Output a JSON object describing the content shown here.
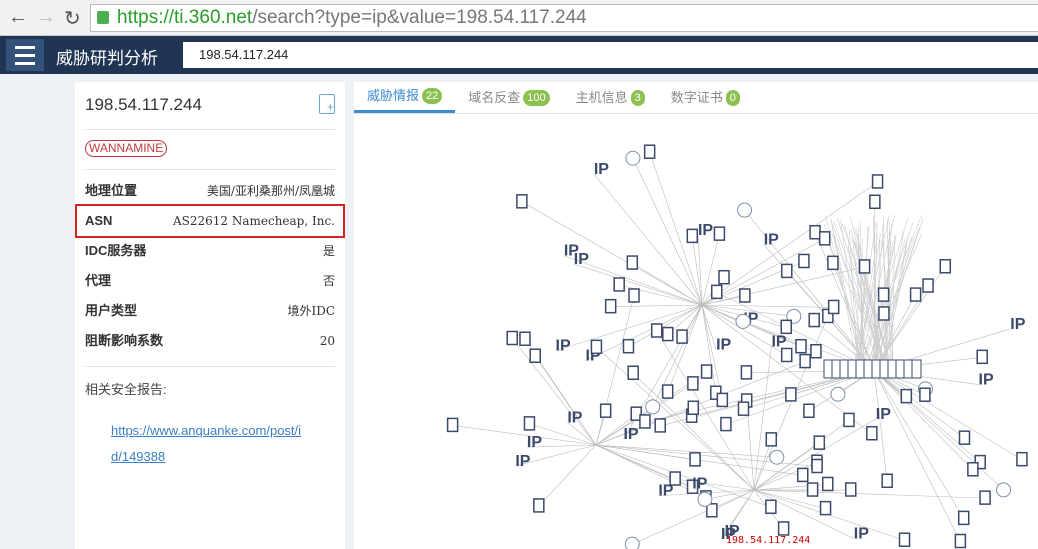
{
  "browser": {
    "url_host": "https://ti.360.net",
    "url_path": "/search?type=ip&value=198.54.117.244"
  },
  "app": {
    "title": "威胁研判分析",
    "search_value": "198.54.117.244"
  },
  "info": {
    "ip": "198.54.117.244",
    "tag": "WANNAMINE",
    "rows": [
      {
        "k": "地理位置",
        "v": "美国/亚利桑那州/凤凰城"
      },
      {
        "k": "ASN",
        "v": "AS22612 Namecheap, Inc."
      },
      {
        "k": "IDC服务器",
        "v": "是"
      },
      {
        "k": "代理",
        "v": "否"
      },
      {
        "k": "用户类型",
        "v": "境外IDC"
      },
      {
        "k": "阻断影响系数",
        "v": "20"
      }
    ],
    "reports_label": "相关安全报告:",
    "report_link": "https://www.anquanke.com/post/id/149388"
  },
  "tabs": [
    {
      "label": "威胁情报",
      "count": "22"
    },
    {
      "label": "域名反查",
      "count": "100"
    },
    {
      "label": "主机信息",
      "count": "3"
    },
    {
      "label": "数字证书",
      "count": "0"
    }
  ],
  "graph": {
    "center_label": "198.54.117.244",
    "ip_label": "IP"
  }
}
